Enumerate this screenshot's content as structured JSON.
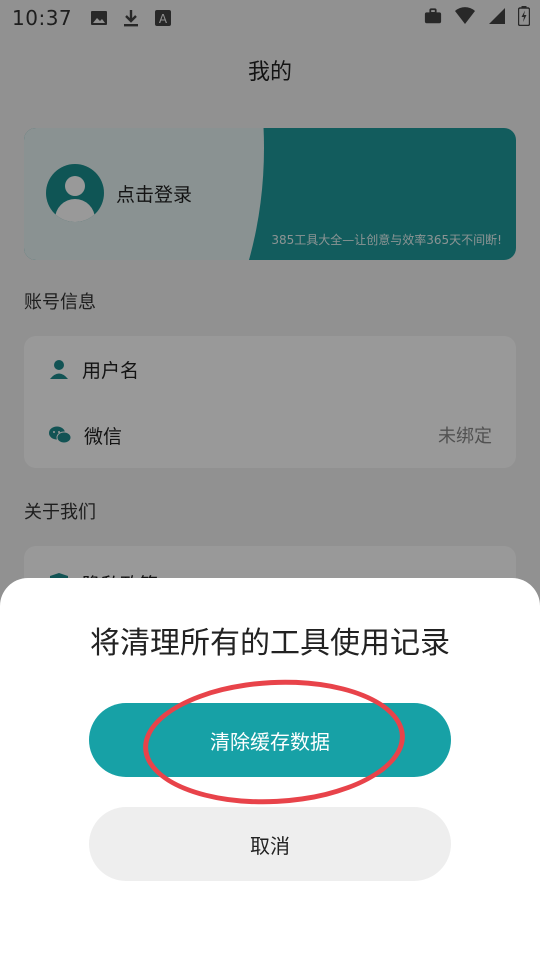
{
  "status_bar": {
    "time": "10:37",
    "left_icons": [
      "image-icon",
      "download-icon",
      "a-icon"
    ],
    "right_icons": [
      "briefcase-icon",
      "wifi-icon",
      "signal-icon",
      "battery-icon"
    ]
  },
  "page": {
    "title": "我的"
  },
  "login_card": {
    "login_text": "点击登录",
    "slogan": "385工具大全—让创意与效率365天不间断!"
  },
  "account_section": {
    "label": "账号信息",
    "rows": [
      {
        "label": "用户名",
        "value": "",
        "icon": "user-icon"
      },
      {
        "label": "微信",
        "value": "未绑定",
        "icon": "wechat-icon"
      }
    ]
  },
  "about_section": {
    "label": "关于我们",
    "rows": [
      {
        "label": "隐私政策",
        "icon": "shield-icon"
      }
    ]
  },
  "dialog": {
    "title": "将清理所有的工具使用记录",
    "confirm_label": "清除缓存数据",
    "cancel_label": "取消"
  },
  "colors": {
    "accent": "#17a1a6",
    "annotation": "#e8434a"
  }
}
